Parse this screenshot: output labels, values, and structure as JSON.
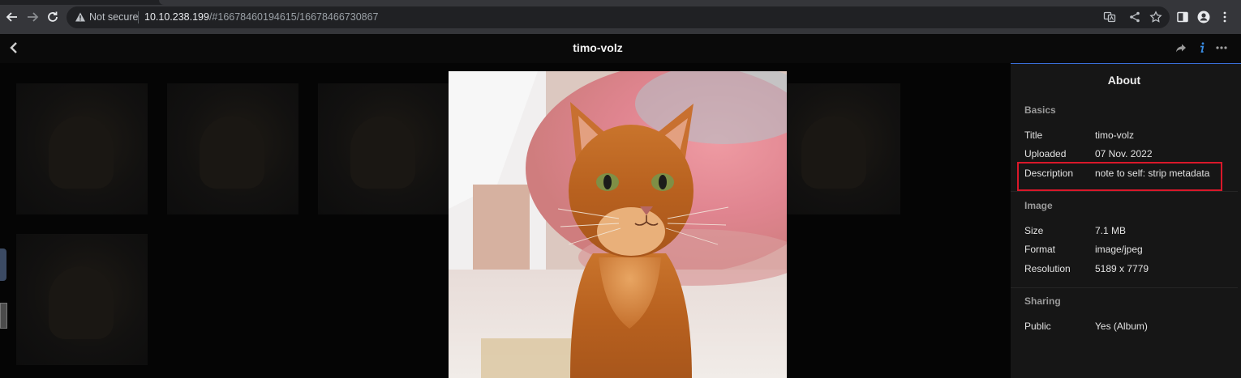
{
  "browser": {
    "security_label": "Not secure",
    "url_host": "10.10.238.199",
    "url_path": "/#16678460194615/16678466730867"
  },
  "viewer": {
    "title": "timo-volz"
  },
  "about_panel": {
    "heading": "About",
    "sections": [
      {
        "title": "Basics",
        "rows": [
          {
            "label": "Title",
            "value": "timo-volz"
          },
          {
            "label": "Uploaded",
            "value": "07 Nov. 2022"
          },
          {
            "label": "Description",
            "value": "note to self: strip metadata"
          }
        ]
      },
      {
        "title": "Image",
        "rows": [
          {
            "label": "Size",
            "value": "7.1 MB"
          },
          {
            "label": "Format",
            "value": "image/jpeg"
          },
          {
            "label": "Resolution",
            "value": "5189 x 7779"
          }
        ]
      },
      {
        "title": "Sharing",
        "rows": [
          {
            "label": "Public",
            "value": "Yes (Album)"
          }
        ]
      }
    ]
  },
  "colors": {
    "accent": "#3a6fd8",
    "highlight": "#d9182a",
    "panel_bg": "#161616"
  }
}
